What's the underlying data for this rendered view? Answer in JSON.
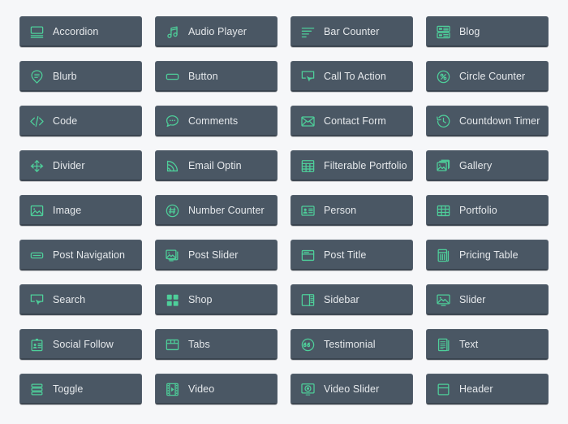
{
  "page": {
    "background_color": "#f6f7f9",
    "card_color": "#4a5764",
    "icon_color": "#4ecf9a",
    "label_color": "#e6e9ec",
    "columns": 4
  },
  "modules": [
    {
      "label": "Accordion",
      "icon": "accordion-icon"
    },
    {
      "label": "Audio Player",
      "icon": "audio-player-icon"
    },
    {
      "label": "Bar Counter",
      "icon": "bar-counter-icon"
    },
    {
      "label": "Blog",
      "icon": "blog-icon"
    },
    {
      "label": "Blurb",
      "icon": "blurb-icon"
    },
    {
      "label": "Button",
      "icon": "button-icon"
    },
    {
      "label": "Call To Action",
      "icon": "call-to-action-icon"
    },
    {
      "label": "Circle Counter",
      "icon": "circle-counter-icon"
    },
    {
      "label": "Code",
      "icon": "code-icon"
    },
    {
      "label": "Comments",
      "icon": "comments-icon"
    },
    {
      "label": "Contact Form",
      "icon": "contact-form-icon"
    },
    {
      "label": "Countdown Timer",
      "icon": "countdown-timer-icon"
    },
    {
      "label": "Divider",
      "icon": "divider-icon"
    },
    {
      "label": "Email Optin",
      "icon": "email-optin-icon"
    },
    {
      "label": "Filterable Portfolio",
      "icon": "filterable-portfolio-icon"
    },
    {
      "label": "Gallery",
      "icon": "gallery-icon"
    },
    {
      "label": "Image",
      "icon": "image-icon"
    },
    {
      "label": "Number Counter",
      "icon": "number-counter-icon"
    },
    {
      "label": "Person",
      "icon": "person-icon"
    },
    {
      "label": "Portfolio",
      "icon": "portfolio-icon"
    },
    {
      "label": "Post Navigation",
      "icon": "post-navigation-icon"
    },
    {
      "label": "Post Slider",
      "icon": "post-slider-icon"
    },
    {
      "label": "Post Title",
      "icon": "post-title-icon"
    },
    {
      "label": "Pricing Table",
      "icon": "pricing-table-icon"
    },
    {
      "label": "Search",
      "icon": "search-icon"
    },
    {
      "label": "Shop",
      "icon": "shop-icon"
    },
    {
      "label": "Sidebar",
      "icon": "sidebar-icon"
    },
    {
      "label": "Slider",
      "icon": "slider-icon"
    },
    {
      "label": "Social Follow",
      "icon": "social-follow-icon"
    },
    {
      "label": "Tabs",
      "icon": "tabs-icon"
    },
    {
      "label": "Testimonial",
      "icon": "testimonial-icon"
    },
    {
      "label": "Text",
      "icon": "text-icon"
    },
    {
      "label": "Toggle",
      "icon": "toggle-icon"
    },
    {
      "label": "Video",
      "icon": "video-icon"
    },
    {
      "label": "Video Slider",
      "icon": "video-slider-icon"
    },
    {
      "label": "Header",
      "icon": "header-icon"
    }
  ]
}
